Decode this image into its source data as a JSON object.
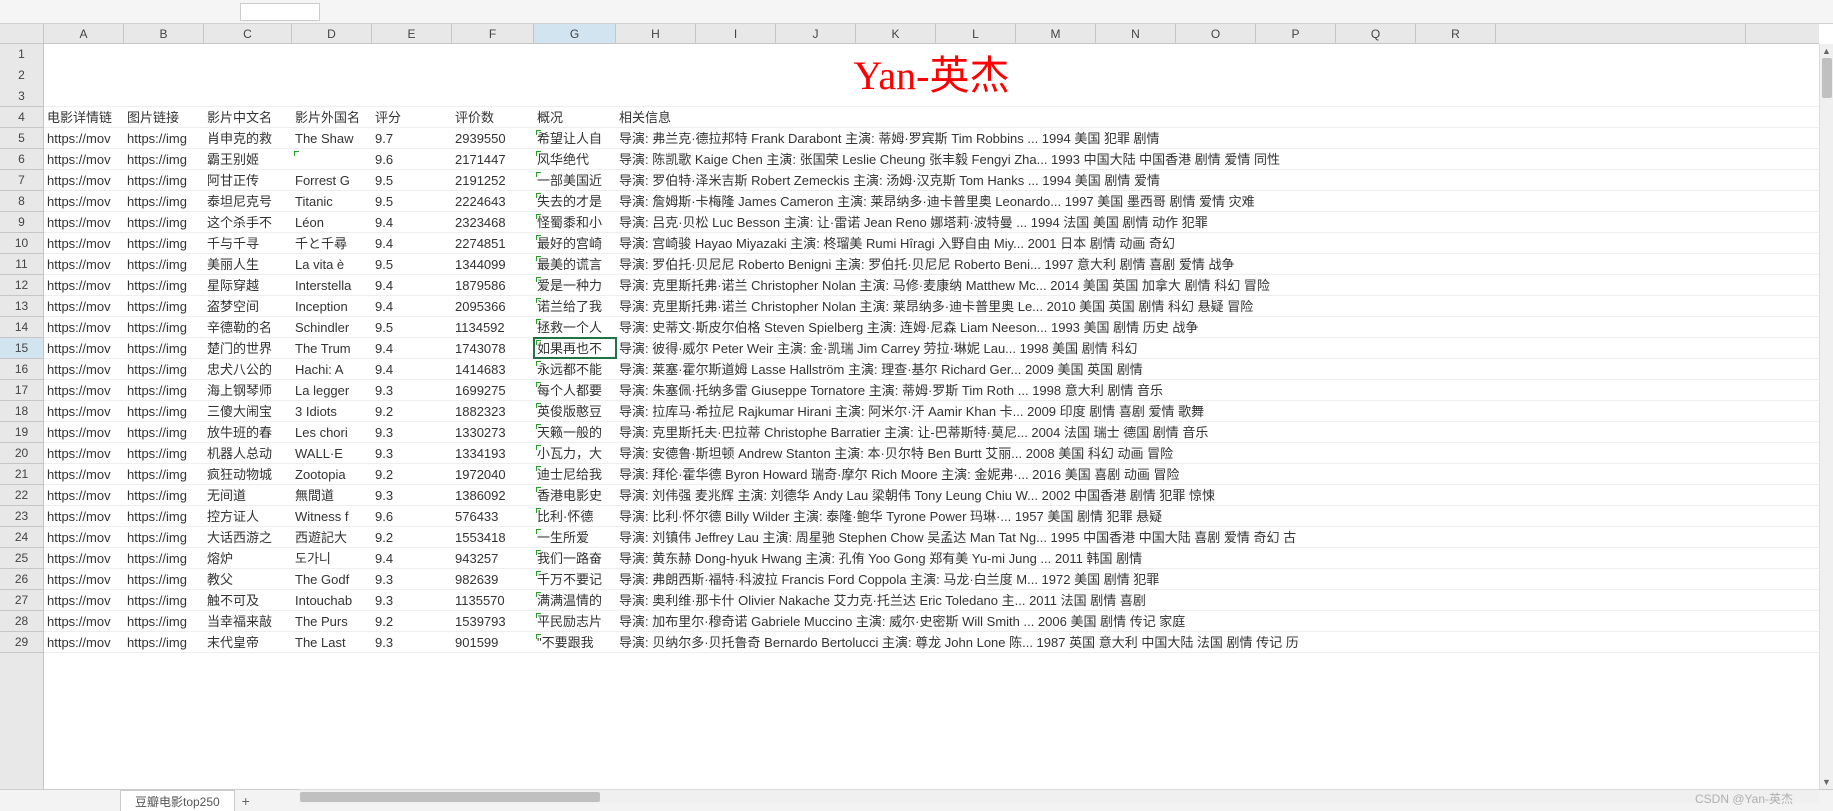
{
  "title": "Yan-英杰",
  "watermark": "CSDN @Yan-英杰",
  "sheet_tab": "豆瓣电影top250",
  "selected_row": 15,
  "selected_col": "G",
  "col_widths": {
    "A": 80,
    "B": 80,
    "C": 88,
    "D": 80,
    "E": 80,
    "F": 82,
    "G": 82,
    "H": 80,
    "I": 80,
    "J": 80,
    "K": 80,
    "L": 80,
    "M": 80,
    "N": 80,
    "O": 80,
    "P": 80,
    "Q": 80,
    "R": 80,
    "extra": 250
  },
  "columns": [
    "A",
    "B",
    "C",
    "D",
    "E",
    "F",
    "G",
    "H",
    "I",
    "J",
    "K",
    "L",
    "M",
    "N",
    "O",
    "P",
    "Q",
    "R"
  ],
  "row_numbers": [
    1,
    2,
    3,
    4,
    5,
    6,
    7,
    8,
    9,
    10,
    11,
    12,
    13,
    14,
    15,
    16,
    17,
    18,
    19,
    20,
    21,
    22,
    23,
    24,
    25,
    26,
    27,
    28,
    29
  ],
  "header_row": [
    "电影详情链",
    "图片链接",
    "影片中文名",
    "影片外国名",
    "评分",
    "评价数",
    "概况",
    "相关信息"
  ],
  "rows": [
    {
      "a": "https://mov",
      "b": "https://img",
      "c": "肖申克的救",
      "d": "The Shaw",
      "e": "9.7",
      "f": "2939550",
      "g": "希望让人自",
      "h": "导演: 弗兰克·德拉邦特 Frank Darabont   主演: 蒂姆·罗宾斯 Tim Robbins   ... 1994   美国   犯罪 剧情"
    },
    {
      "a": "https://mov",
      "b": "https://img",
      "c": "霸王别姬",
      "d": "",
      "e": "9.6",
      "f": "2171447",
      "g": "风华绝代",
      "h": "导演: 陈凯歌 Kaige Chen   主演: 张国荣 Leslie Cheung   张丰毅 Fengyi Zha... 1993   中国大陆 中国香港   剧情 爱情 同性"
    },
    {
      "a": "https://mov",
      "b": "https://img",
      "c": "阿甘正传",
      "d": "Forrest G",
      "e": "9.5",
      "f": "2191252",
      "g": "一部美国近",
      "h": "导演: 罗伯特·泽米吉斯 Robert Zemeckis   主演: 汤姆·汉克斯 Tom Hanks   ... 1994   美国   剧情 爱情"
    },
    {
      "a": "https://mov",
      "b": "https://img",
      "c": "泰坦尼克号",
      "d": "Titanic",
      "e": "9.5",
      "f": "2224643",
      "g": "失去的才是",
      "h": "导演: 詹姆斯·卡梅隆 James Cameron   主演: 莱昂纳多·迪卡普里奥 Leonardo... 1997   美国 墨西哥   剧情 爱情 灾难"
    },
    {
      "a": "https://mov",
      "b": "https://img",
      "c": "这个杀手不",
      "d": "Léon",
      "e": "9.4",
      "f": "2323468",
      "g": "怪蜀黍和小",
      "h": "导演: 吕克·贝松 Luc Besson   主演: 让·雷诺 Jean Reno   娜塔莉·波特曼 ... 1994   法国 美国   剧情 动作 犯罪"
    },
    {
      "a": "https://mov",
      "b": "https://img",
      "c": "千与千寻",
      "d": "千と千尋",
      "e": "9.4",
      "f": "2274851",
      "g": "最好的宫崎",
      "h": "导演: 宫崎骏 Hayao Miyazaki   主演: 柊瑠美 Rumi Hîragi   入野自由 Miy... 2001   日本   剧情 动画 奇幻"
    },
    {
      "a": "https://mov",
      "b": "https://img",
      "c": "美丽人生",
      "d": "La vita è",
      "e": "9.5",
      "f": "1344099",
      "g": "最美的谎言",
      "h": "导演: 罗伯托·贝尼尼 Roberto Benigni   主演: 罗伯托·贝尼尼 Roberto Beni... 1997   意大利   剧情 喜剧 爱情 战争"
    },
    {
      "a": "https://mov",
      "b": "https://img",
      "c": "星际穿越",
      "d": "Interstella",
      "e": "9.4",
      "f": "1879586",
      "g": "爱是一种力",
      "h": "导演: 克里斯托弗·诺兰 Christopher Nolan   主演: 马修·麦康纳 Matthew Mc... 2014   美国 英国 加拿大   剧情 科幻 冒险"
    },
    {
      "a": "https://mov",
      "b": "https://img",
      "c": "盗梦空间",
      "d": "Inception",
      "e": "9.4",
      "f": "2095366",
      "g": "诺兰给了我",
      "h": "导演: 克里斯托弗·诺兰 Christopher Nolan   主演: 莱昂纳多·迪卡普里奥 Le... 2010   美国 英国   剧情 科幻 悬疑 冒险"
    },
    {
      "a": "https://mov",
      "b": "https://img",
      "c": "辛德勒的名",
      "d": "Schindler",
      "e": "9.5",
      "f": "1134592",
      "g": "拯救一个人",
      "h": "导演: 史蒂文·斯皮尔伯格 Steven Spielberg   主演: 连姆·尼森 Liam Neeson... 1993   美国   剧情 历史 战争"
    },
    {
      "a": "https://mov",
      "b": "https://img",
      "c": "楚门的世界",
      "d": "The Trum",
      "e": "9.4",
      "f": "1743078",
      "g": "如果再也不",
      "h": "导演: 彼得·威尔 Peter Weir   主演: 金·凯瑞 Jim Carrey   劳拉·琳妮 Lau... 1998   美国   剧情 科幻"
    },
    {
      "a": "https://mov",
      "b": "https://img",
      "c": "忠犬八公的",
      "d": "Hachi: A",
      "e": "9.4",
      "f": "1414683",
      "g": "永远都不能",
      "h": "导演: 莱塞·霍尔斯道姆 Lasse Hallström   主演: 理查·基尔 Richard Ger... 2009   美国 英国   剧情"
    },
    {
      "a": "https://mov",
      "b": "https://img",
      "c": "海上钢琴师",
      "d": "La legger",
      "e": "9.3",
      "f": "1699275",
      "g": "每个人都要",
      "h": "导演: 朱塞佩·托纳多雷 Giuseppe Tornatore   主演: 蒂姆·罗斯 Tim Roth   ... 1998   意大利   剧情 音乐"
    },
    {
      "a": "https://mov",
      "b": "https://img",
      "c": "三傻大闹宝",
      "d": "3 Idiots",
      "e": "9.2",
      "f": "1882323",
      "g": "英俊版憨豆",
      "h": "导演: 拉库马·希拉尼 Rajkumar Hirani   主演: 阿米尔·汗 Aamir Khan   卡... 2009   印度   剧情 喜剧 爱情 歌舞"
    },
    {
      "a": "https://mov",
      "b": "https://img",
      "c": "放牛班的春",
      "d": "Les chori",
      "e": "9.3",
      "f": "1330273",
      "g": "天籁一般的",
      "h": "导演: 克里斯托夫·巴拉蒂 Christophe Barratier   主演: 让-巴蒂斯特·莫尼... 2004   法国 瑞士 德国   剧情 音乐"
    },
    {
      "a": "https://mov",
      "b": "https://img",
      "c": "机器人总动",
      "d": "WALL·E",
      "e": "9.3",
      "f": "1334193",
      "g": "小瓦力，大",
      "h": "导演: 安德鲁·斯坦顿 Andrew Stanton   主演: 本·贝尔特 Ben Burtt   艾丽... 2008   美国   科幻 动画 冒险"
    },
    {
      "a": "https://mov",
      "b": "https://img",
      "c": "疯狂动物城",
      "d": "Zootopia",
      "e": "9.2",
      "f": "1972040",
      "g": "迪士尼给我",
      "h": "导演: 拜伦·霍华德 Byron Howard   瑞奇·摩尔 Rich Moore   主演: 金妮弗·... 2016   美国   喜剧 动画 冒险"
    },
    {
      "a": "https://mov",
      "b": "https://img",
      "c": "无间道",
      "d": "無間道",
      "e": "9.3",
      "f": "1386092",
      "g": "香港电影史",
      "h": "导演: 刘伟强   麦兆辉   主演: 刘德华 Andy Lau   梁朝伟 Tony Leung Chiu W... 2002   中国香港   剧情 犯罪 惊悚"
    },
    {
      "a": "https://mov",
      "b": "https://img",
      "c": "控方证人",
      "d": "Witness f",
      "e": "9.6",
      "f": "576433",
      "g": "比利·怀德",
      "h": "导演: 比利·怀尔德 Billy Wilder   主演: 泰隆·鲍华 Tyrone Power   玛琳·... 1957   美国   剧情 犯罪 悬疑"
    },
    {
      "a": "https://mov",
      "b": "https://img",
      "c": "大话西游之",
      "d": "西遊記大",
      "e": "9.2",
      "f": "1553418",
      "g": "一生所爱",
      "h": "导演: 刘镇伟 Jeffrey Lau   主演: 周星驰 Stephen Chow   吴孟达 Man Tat Ng... 1995   中国香港 中国大陆   喜剧 爱情 奇幻 古"
    },
    {
      "a": "https://mov",
      "b": "https://img",
      "c": "熔炉",
      "d": "도가니",
      "e": "9.4",
      "f": "943257",
      "g": "我们一路奋",
      "h": "导演: 黄东赫 Dong-hyuk Hwang   主演: 孔侑 Yoo Gong   郑有美 Yu-mi Jung ... 2011   韩国   剧情"
    },
    {
      "a": "https://mov",
      "b": "https://img",
      "c": "教父",
      "d": "The Godf",
      "e": "9.3",
      "f": "982639",
      "g": "千万不要记",
      "h": "导演: 弗朗西斯·福特·科波拉 Francis Ford Coppola   主演: 马龙·白兰度 M... 1972   美国   剧情 犯罪"
    },
    {
      "a": "https://mov",
      "b": "https://img",
      "c": "触不可及",
      "d": "Intouchab",
      "e": "9.3",
      "f": "1135570",
      "g": "满满温情的",
      "h": "导演: 奥利维·那卡什 Olivier Nakache   艾力克·托兰达 Eric Toledano   主... 2011   法国   剧情 喜剧"
    },
    {
      "a": "https://mov",
      "b": "https://img",
      "c": "当幸福来敲",
      "d": "The Purs",
      "e": "9.2",
      "f": "1539793",
      "g": "平民励志片",
      "h": "导演: 加布里尔·穆奇诺 Gabriele Muccino   主演: 威尔·史密斯 Will Smith ... 2006   美国   剧情 传记 家庭"
    },
    {
      "a": "https://mov",
      "b": "https://img",
      "c": "末代皇帝",
      "d": "The Last",
      "e": "9.3",
      "f": "901599",
      "g": "\"不要跟我",
      "h": "导演: 贝纳尔多·贝托鲁奇 Bernardo Bertolucci   主演: 尊龙 John Lone   陈... 1987   英国 意大利 中国大陆 法国   剧情 传记 历"
    }
  ]
}
